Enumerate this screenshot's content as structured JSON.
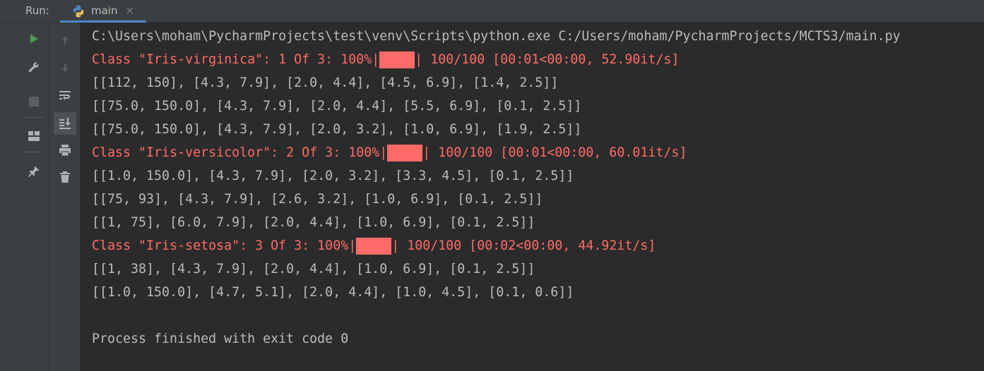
{
  "tabbar": {
    "run_label": "Run:",
    "tab": {
      "label": "main",
      "icon": "python-icon",
      "close_glyph": "×"
    }
  },
  "toolbar": {
    "left": [
      "run-icon",
      "wrench-icon",
      "stop-icon",
      "layout-icon",
      "pin-icon"
    ],
    "right": [
      "arrow-up-icon",
      "arrow-down-icon",
      "soft-wrap-icon",
      "scroll-to-end-icon",
      "print-icon",
      "trash-icon"
    ]
  },
  "colors": {
    "stderr": "#ff6b68",
    "stdout": "#bbbbbb",
    "run_green": "#499c54",
    "background": "#2b2b2b",
    "panel": "#3c3f41",
    "tab_accent": "#4a88c7"
  },
  "console": {
    "lines": [
      {
        "kind": "out",
        "text": "C:\\Users\\moham\\PycharmProjects\\test\\venv\\Scripts\\python.exe C:/Users/moham/PycharmProjects/MCTS3/main.py"
      },
      {
        "kind": "progress",
        "prefix": "Class \"Iris-virginica\": 1 Of 3: 100%|",
        "fill": 1.0,
        "suffix": "| 100/100 [00:01<00:00, 52.90it/s]"
      },
      {
        "kind": "out",
        "text": "[[112, 150], [4.3, 7.9], [2.0, 4.4], [4.5, 6.9], [1.4, 2.5]]"
      },
      {
        "kind": "out",
        "text": "[[75.0, 150.0], [4.3, 7.9], [2.0, 4.4], [5.5, 6.9], [0.1, 2.5]]"
      },
      {
        "kind": "out",
        "text": "[[75.0, 150.0], [4.3, 7.9], [2.0, 3.2], [1.0, 6.9], [1.9, 2.5]]"
      },
      {
        "kind": "progress",
        "prefix": "Class \"Iris-versicolor\": 2 Of 3: 100%|",
        "fill": 1.0,
        "suffix": "| 100/100 [00:01<00:00, 60.01it/s]"
      },
      {
        "kind": "out",
        "text": "[[1.0, 150.0], [4.3, 7.9], [2.0, 3.2], [3.3, 4.5], [0.1, 2.5]]"
      },
      {
        "kind": "out",
        "text": "[[75, 93], [4.3, 7.9], [2.6, 3.2], [1.0, 6.9], [0.1, 2.5]]"
      },
      {
        "kind": "out",
        "text": "[[1, 75], [6.0, 7.9], [2.0, 4.4], [1.0, 6.9], [0.1, 2.5]]"
      },
      {
        "kind": "progress",
        "prefix": "Class \"Iris-setosa\": 3 Of 3: 100%|",
        "fill": 1.0,
        "suffix": "| 100/100 [00:02<00:00, 44.92it/s]"
      },
      {
        "kind": "out",
        "text": "[[1, 38], [4.3, 7.9], [2.0, 4.4], [1.0, 6.9], [0.1, 2.5]]"
      },
      {
        "kind": "out",
        "text": "[[1.0, 150.0], [4.7, 5.1], [2.0, 4.4], [1.0, 4.5], [0.1, 0.6]]"
      },
      {
        "kind": "out",
        "text": ""
      },
      {
        "kind": "out",
        "text": "Process finished with exit code 0"
      }
    ]
  }
}
